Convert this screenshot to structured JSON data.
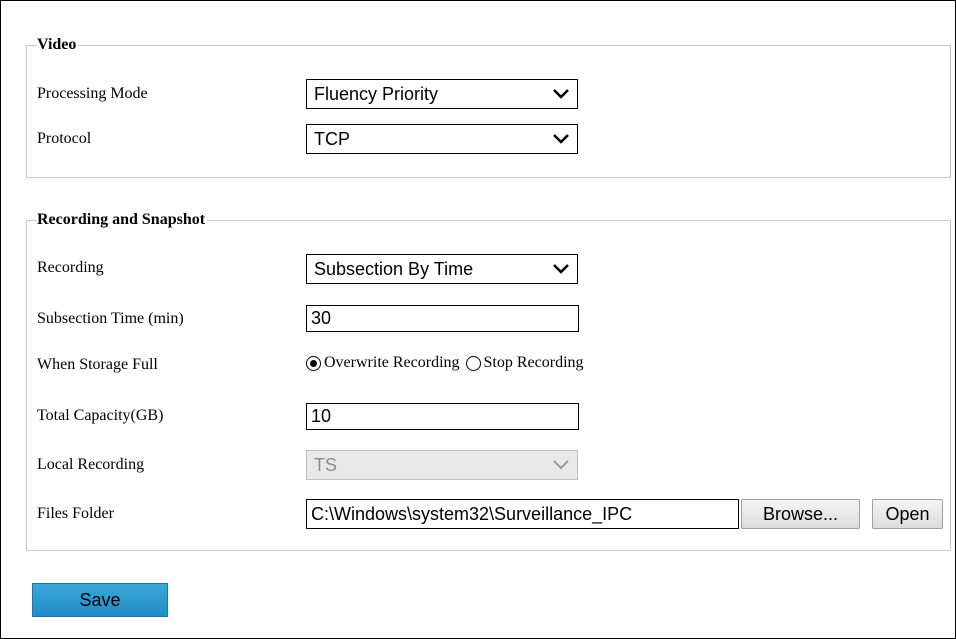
{
  "video": {
    "legend": "Video",
    "processing_mode": {
      "label": "Processing Mode",
      "value": "Fluency Priority"
    },
    "protocol": {
      "label": "Protocol",
      "value": "TCP"
    }
  },
  "recording_snapshot": {
    "legend": "Recording and Snapshot",
    "recording": {
      "label": "Recording",
      "value": "Subsection By Time"
    },
    "subsection_time": {
      "label": "Subsection Time (min)",
      "value": "30"
    },
    "when_storage_full": {
      "label": "When Storage Full",
      "options": [
        "Overwrite Recording",
        "Stop Recording"
      ],
      "selected": "Overwrite Recording"
    },
    "total_capacity": {
      "label": "Total Capacity(GB)",
      "value": "10"
    },
    "local_recording": {
      "label": "Local Recording",
      "value": "TS",
      "disabled": true
    },
    "files_folder": {
      "label": "Files Folder",
      "value": "C:\\Windows\\system32\\Surveillance_IPC",
      "browse_label": "Browse...",
      "open_label": "Open"
    }
  },
  "actions": {
    "save_label": "Save"
  },
  "colors": {
    "save_button": "#2196cf",
    "group_border": "#c8c8c8",
    "disabled_bg": "#e8e8e8"
  },
  "icons": {
    "dropdown": "chevron-down-icon"
  }
}
